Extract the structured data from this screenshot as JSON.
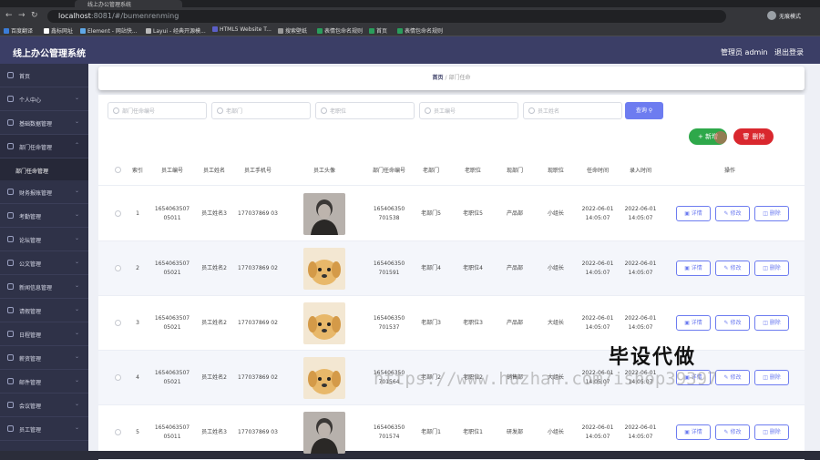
{
  "browser": {
    "tab_title": "线上办公管理系统",
    "url_host": "localhost",
    "url_rest": ":8081/#/bumenrenming",
    "profile_label": "无痕模式",
    "bookmarks": [
      "百度翻译",
      "鑫标网址",
      "Element - 网站快...",
      "Layui - 经典开源模...",
      "HTML5 Website T...",
      "搜索壁纸",
      "表情包命名规则",
      "首页",
      "表情包命名规则"
    ]
  },
  "header": {
    "app_title": "线上办公管理系统",
    "user_label": "管理员 admin",
    "logout_label": "退出登录"
  },
  "sidebar": {
    "items": [
      {
        "label": "首页"
      },
      {
        "label": "个人中心"
      },
      {
        "label": "基础数据管理"
      },
      {
        "label": "部门任命管理"
      },
      {
        "label": "财务报账管理"
      },
      {
        "label": "考勤管理"
      },
      {
        "label": "论坛管理"
      },
      {
        "label": "公文管理"
      },
      {
        "label": "新闻信息管理"
      },
      {
        "label": "请假管理"
      },
      {
        "label": "日程管理"
      },
      {
        "label": "薪资管理"
      },
      {
        "label": "邮件管理"
      },
      {
        "label": "会议管理"
      },
      {
        "label": "员工管理"
      }
    ],
    "sub_item": "部门任命管理"
  },
  "breadcrumb": {
    "home": "首页",
    "separator": "/",
    "current": "部门任命"
  },
  "search": {
    "placeholders": [
      "部门任命编号",
      "老部门",
      "老职位",
      "员工编号",
      "员工姓名"
    ],
    "query_label": "查询"
  },
  "actions": {
    "add_label": "新增",
    "delete_label": "删除"
  },
  "table": {
    "headers": [
      "索引",
      "员工编号",
      "员工姓名",
      "员工手机号",
      "员工头像",
      "部门任命编号",
      "老部门",
      "老职位",
      "现部门",
      "现职位",
      "任命时间",
      "录入时间",
      "操作"
    ],
    "op_labels": {
      "detail": "详情",
      "edit": "修改",
      "delete": "删除"
    },
    "rows": [
      {
        "index": "1",
        "emp_no": "1654063507 05011",
        "name": "员工姓名3",
        "phone": "177037869 03",
        "avatar": "man",
        "appoint_no": "165406350 701538",
        "old_dept": "老部门5",
        "old_pos": "老职位5",
        "new_dept": "产品部",
        "new_pos": "小组长",
        "appoint_time": "2022-06-01 14:05:07",
        "entry_time": "2022-06-01 14:05:07"
      },
      {
        "index": "2",
        "emp_no": "1654063507 05021",
        "name": "员工姓名2",
        "phone": "177037869 02",
        "avatar": "dog",
        "appoint_no": "165406350 701591",
        "old_dept": "老部门4",
        "old_pos": "老职位4",
        "new_dept": "产品部",
        "new_pos": "小组长",
        "appoint_time": "2022-06-01 14:05:07",
        "entry_time": "2022-06-01 14:05:07"
      },
      {
        "index": "3",
        "emp_no": "1654063507 05021",
        "name": "员工姓名2",
        "phone": "177037869 02",
        "avatar": "dog",
        "appoint_no": "165406350 701537",
        "old_dept": "老部门3",
        "old_pos": "老职位3",
        "new_dept": "产品部",
        "new_pos": "大组长",
        "appoint_time": "2022-06-01 14:05:07",
        "entry_time": "2022-06-01 14:05:07"
      },
      {
        "index": "4",
        "emp_no": "1654063507 05021",
        "name": "员工姓名2",
        "phone": "177037869 02",
        "avatar": "dog",
        "appoint_no": "165406350 701564",
        "old_dept": "老部门2",
        "old_pos": "老职位2",
        "new_dept": "销售部",
        "new_pos": "大组长",
        "appoint_time": "2022-06-01 14:05:07",
        "entry_time": "2022-06-01 14:05:07"
      },
      {
        "index": "5",
        "emp_no": "1654063507 05011",
        "name": "员工姓名3",
        "phone": "177037869 03",
        "avatar": "man",
        "appoint_no": "165406350 701574",
        "old_dept": "老部门1",
        "old_pos": "老职位1",
        "new_dept": "研发部",
        "new_pos": "小组长",
        "appoint_time": "2022-06-01 14:05:07",
        "entry_time": "2022-06-01 14:05:07"
      }
    ]
  },
  "watermark": {
    "text": "毕设代做",
    "url": "https://www.huzhan.com/ishop39397"
  },
  "colors": {
    "header_bg": "#3b3e66",
    "sidebar_bg": "#2f3248",
    "primary": "#6d7cf0",
    "success": "#2ea84a",
    "danger": "#d9272e"
  }
}
